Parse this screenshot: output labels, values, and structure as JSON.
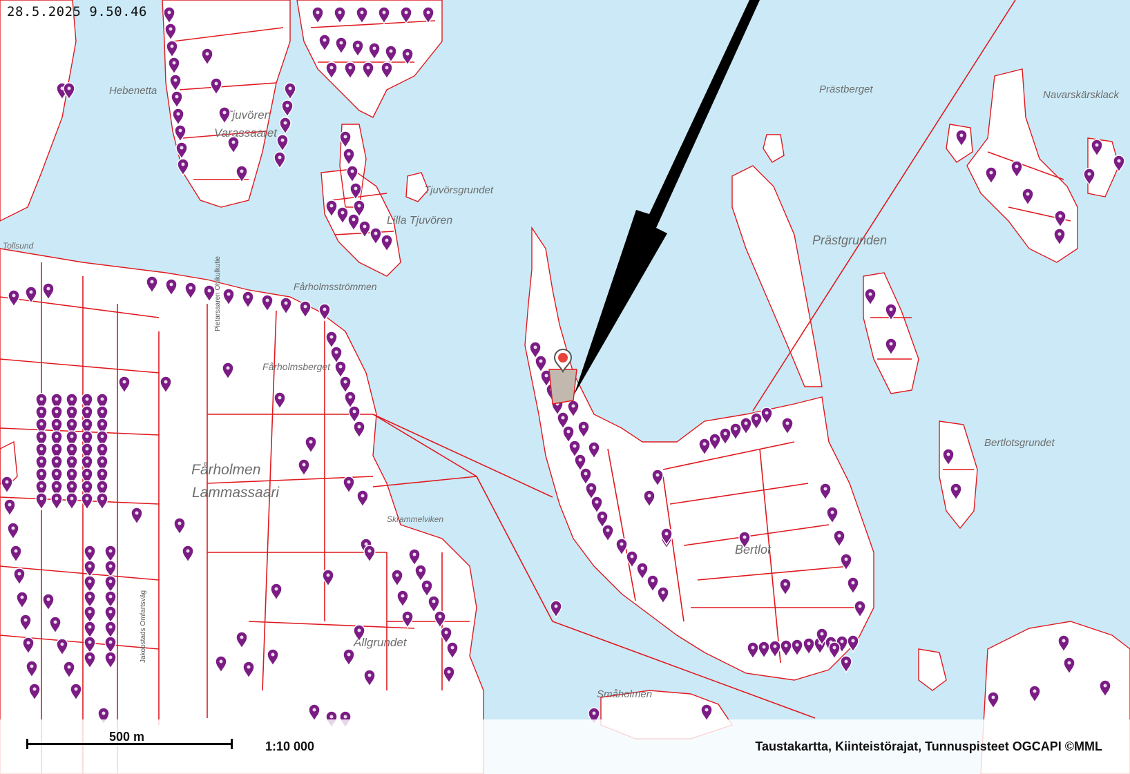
{
  "timestamp": "28.5.2025 9.50.46",
  "colors": {
    "water": "#cbe9f6",
    "land": "#ffffff",
    "parcel_boundary": "#e0191f",
    "marker": "#7b1c84",
    "selected_marker": "#e8433a",
    "arrow": "#000000"
  },
  "place_labels": [
    "Hebenetta",
    "Tjuvören",
    "Varassaaret",
    "Tjuvörsgrundet",
    "Lilla Tjuvören",
    "Prästberget",
    "Navarskärsklack",
    "Prästgrunden",
    "Fårholmsströmmen",
    "Fårholmsberget",
    "Fårholmen",
    "Lammassaari",
    "Skrammelviken",
    "Bertlot",
    "Bertlotsgrundet",
    "Allgrundet",
    "Småholmen",
    "Tollsund"
  ],
  "road_labels": [
    "Jakobstads Omfartsväg",
    "Pietarsaaren Ohikulkutie"
  ],
  "scale": {
    "label": "500 m",
    "ratio": "1:10 000"
  },
  "attribution": "Taustakartta, Kiinteistörajat, Tunnuspisteet OGCAPI ©MML",
  "icons": [
    "map-pin-icon",
    "selected-location-pin-icon",
    "pointer-arrow"
  ]
}
